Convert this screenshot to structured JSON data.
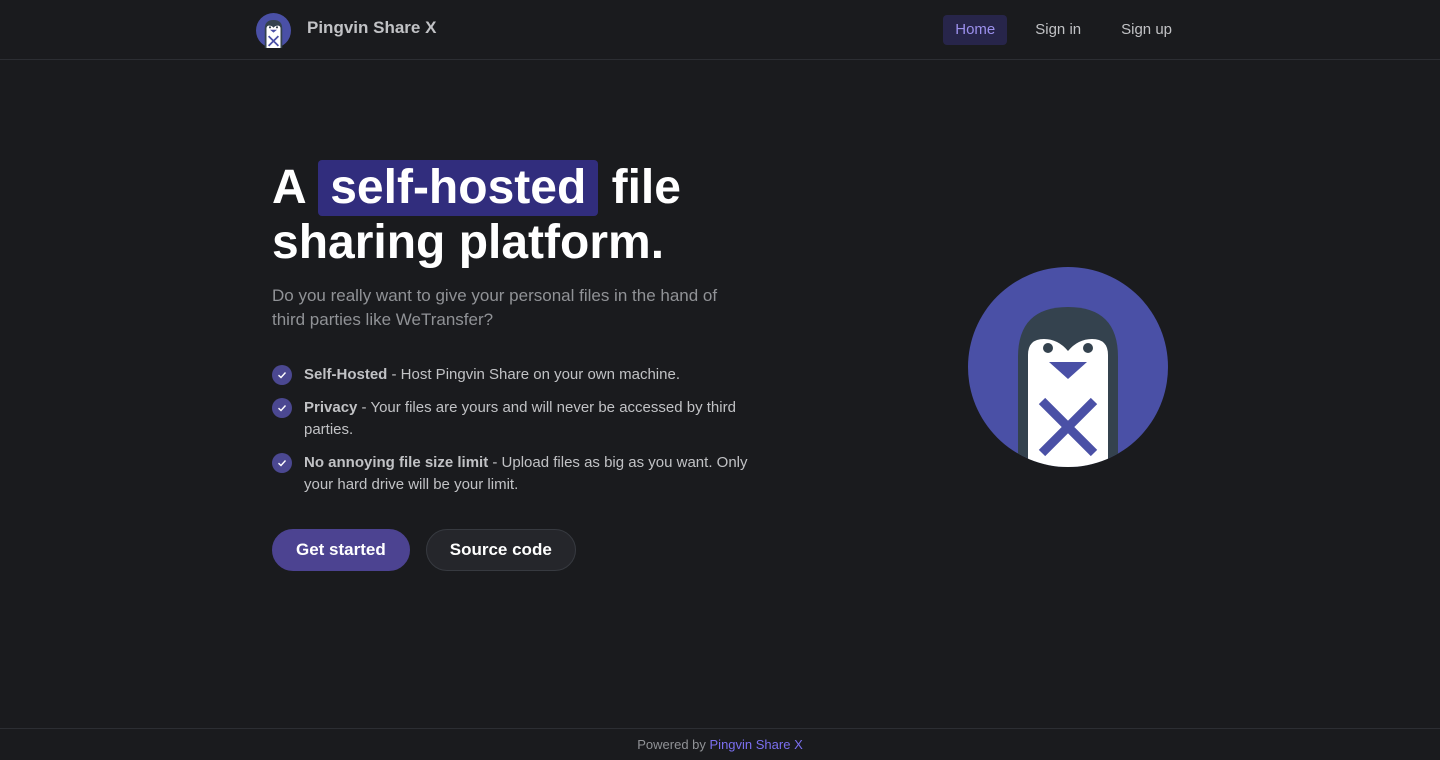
{
  "header": {
    "title": "Pingvin Share X",
    "logo_icon": "penguin-logo-icon",
    "nav": [
      {
        "label": "Home",
        "active": true
      },
      {
        "label": "Sign in",
        "active": false
      },
      {
        "label": "Sign up",
        "active": false
      }
    ]
  },
  "hero": {
    "title_prefix": "A",
    "title_highlight": "self-hosted",
    "title_suffix": "file sharing platform.",
    "description": "Do you really want to give your personal files in the hand of third parties like WeTransfer?",
    "features": [
      {
        "title": "Self-Hosted",
        "text": " - Host Pingvin Share on your own machine.",
        "icon": "check-icon"
      },
      {
        "title": "Privacy",
        "text": " - Your files are yours and will never be accessed by third parties.",
        "icon": "check-icon"
      },
      {
        "title": "No annoying file size limit",
        "text": " - Upload files as big as you want. Only your hard drive will be your limit.",
        "icon": "check-icon"
      }
    ],
    "buttons": {
      "primary": "Get started",
      "secondary": "Source code"
    },
    "logo_icon": "penguin-logo-icon"
  },
  "footer": {
    "prefix": "Powered by ",
    "link": "Pingvin Share X"
  },
  "colors": {
    "background": "#1a1b1e",
    "accent": "#4c4391",
    "highlight": "#312d7d",
    "logo_circle": "#4a50a6",
    "link": "#7b6ff0"
  }
}
